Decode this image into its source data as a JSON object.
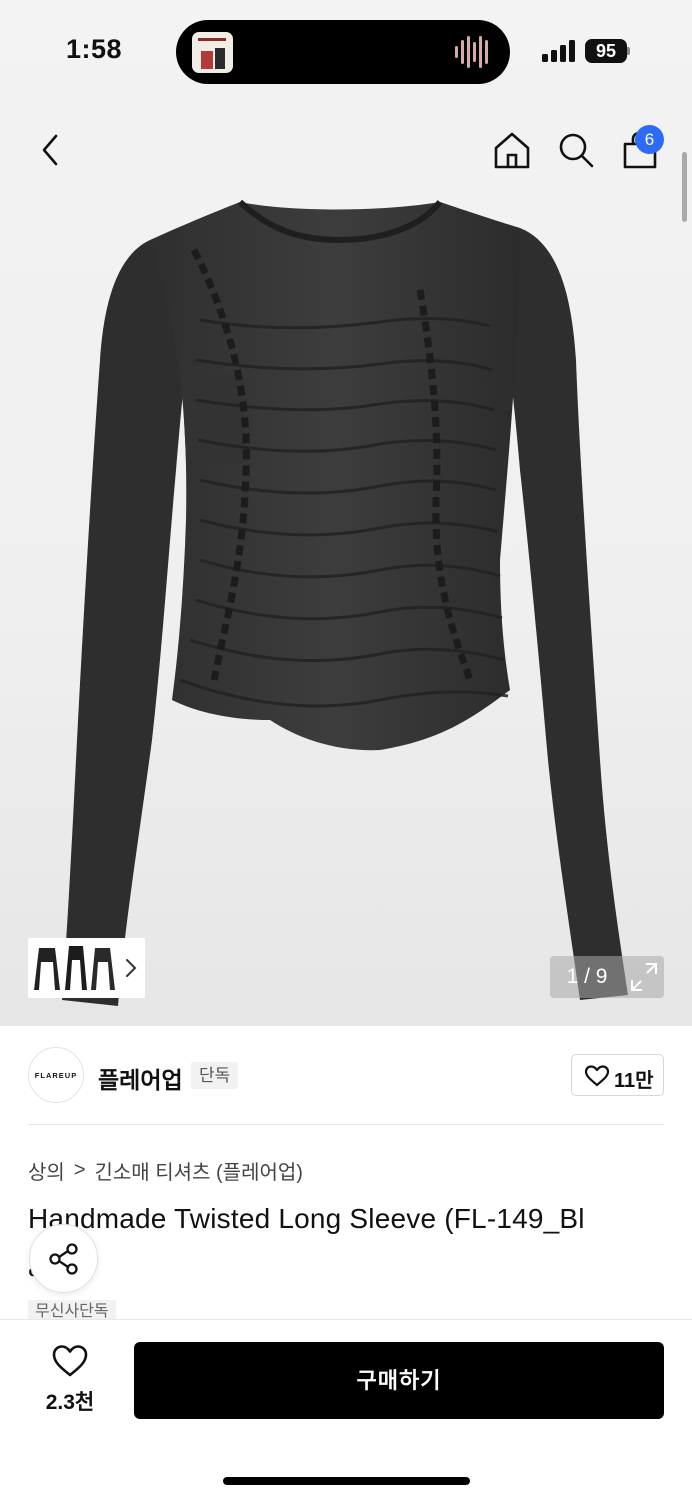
{
  "status_bar": {
    "time": "1:58",
    "battery": "95"
  },
  "nav": {
    "cart_count": "6"
  },
  "gallery": {
    "counter": "1 / 9"
  },
  "brand": {
    "logo_text": "FLAREUP",
    "name": "플레어업",
    "tag": "단독",
    "likes": "11만"
  },
  "breadcrumb": {
    "level1": "상의",
    "separator": ">",
    "level2": "긴소매 티셔츠 (플레어업)"
  },
  "product": {
    "title": "Handmade Twisted Long Sleeve (FL-149_Bl",
    "title_line2": "a",
    "badge": "무신사단독"
  },
  "bottom": {
    "wish_count": "2.3천",
    "buy_label": "구매하기"
  },
  "colors": {
    "accent_badge": "#2e6bf5",
    "buy_button": "#000000",
    "garment": "#3a3a3a"
  }
}
